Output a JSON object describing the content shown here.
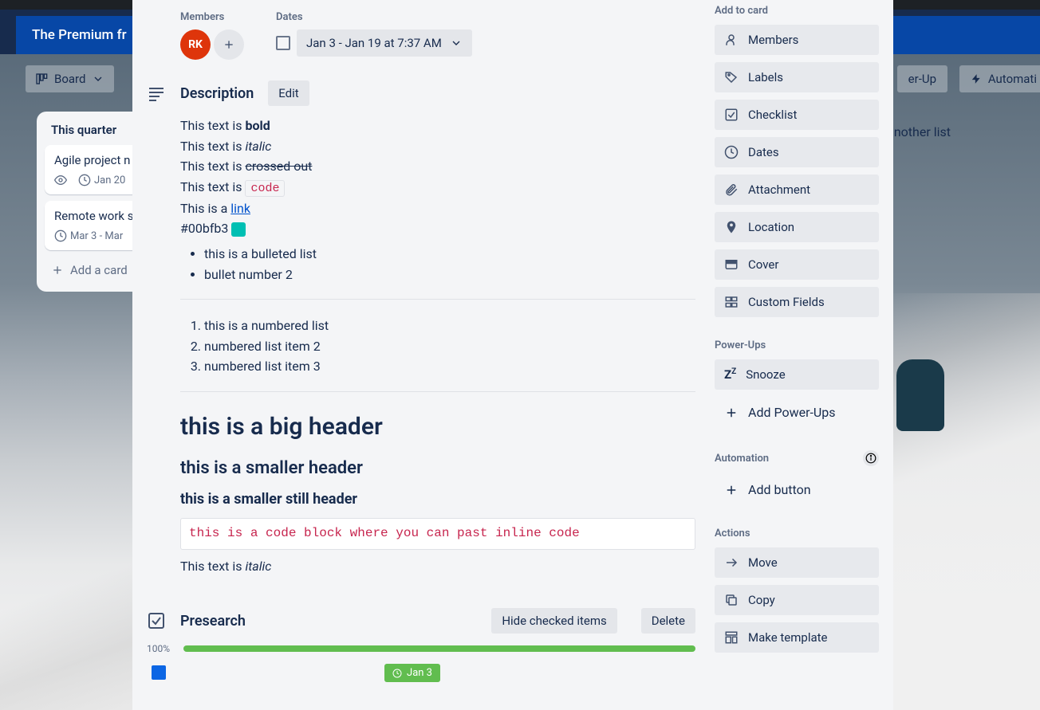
{
  "banner": {
    "text": "The Premium fr"
  },
  "board_btn": {
    "label": "Board"
  },
  "top_btns": {
    "powerup": "er-Up",
    "automation": "Automati"
  },
  "list": {
    "title": "This quarter",
    "cards": [
      {
        "title": "Agile project n",
        "date": "Jan 20",
        "watch": true
      },
      {
        "title": "Remote work s",
        "date": "Mar 3 - Mar"
      }
    ],
    "add": "Add a card"
  },
  "add_list": {
    "label": "Add another list"
  },
  "members": {
    "label": "Members",
    "initials": "RK"
  },
  "dates": {
    "label": "Dates",
    "text": "Jan 3 - Jan 19 at 7:37 AM"
  },
  "description": {
    "title": "Description",
    "edit": "Edit",
    "lines": {
      "pre_bold": "This text is ",
      "bold": "bold",
      "pre_italic": "This text is ",
      "italic": "italic",
      "pre_strike": "This text is ",
      "strike": "crossed out",
      "pre_code": "This text is ",
      "code": "code",
      "pre_link": "This is a ",
      "link": "link",
      "hex": "#00bfb3",
      "swatch_color": "#00bfb3",
      "bullet1": "this is a bulleted list",
      "bullet2": "bullet number 2",
      "num1": "this is a numbered list",
      "num2": "numbered list item 2",
      "num3": "numbered list item 3",
      "h1": "this is a big header",
      "h2": "this is a smaller header",
      "h3": "this is a smaller still header",
      "codeblock": "this is a code block where you can past inline code",
      "pre_italic2": "This text is ",
      "italic2": "italic"
    }
  },
  "checklist": {
    "title": "Presearch",
    "hide": "Hide checked items",
    "delete": "Delete",
    "pct": "100%",
    "item_date": "Jan 3"
  },
  "sidebar": {
    "add_label": "Add to card",
    "items": [
      "Members",
      "Labels",
      "Checklist",
      "Dates",
      "Attachment",
      "Location",
      "Cover",
      "Custom Fields"
    ],
    "powerups_label": "Power-Ups",
    "snooze": "Snooze",
    "add_powerups": "Add Power-Ups",
    "automation_label": "Automation",
    "add_button": "Add button",
    "actions_label": "Actions",
    "actions": [
      "Move",
      "Copy",
      "Make template"
    ]
  }
}
